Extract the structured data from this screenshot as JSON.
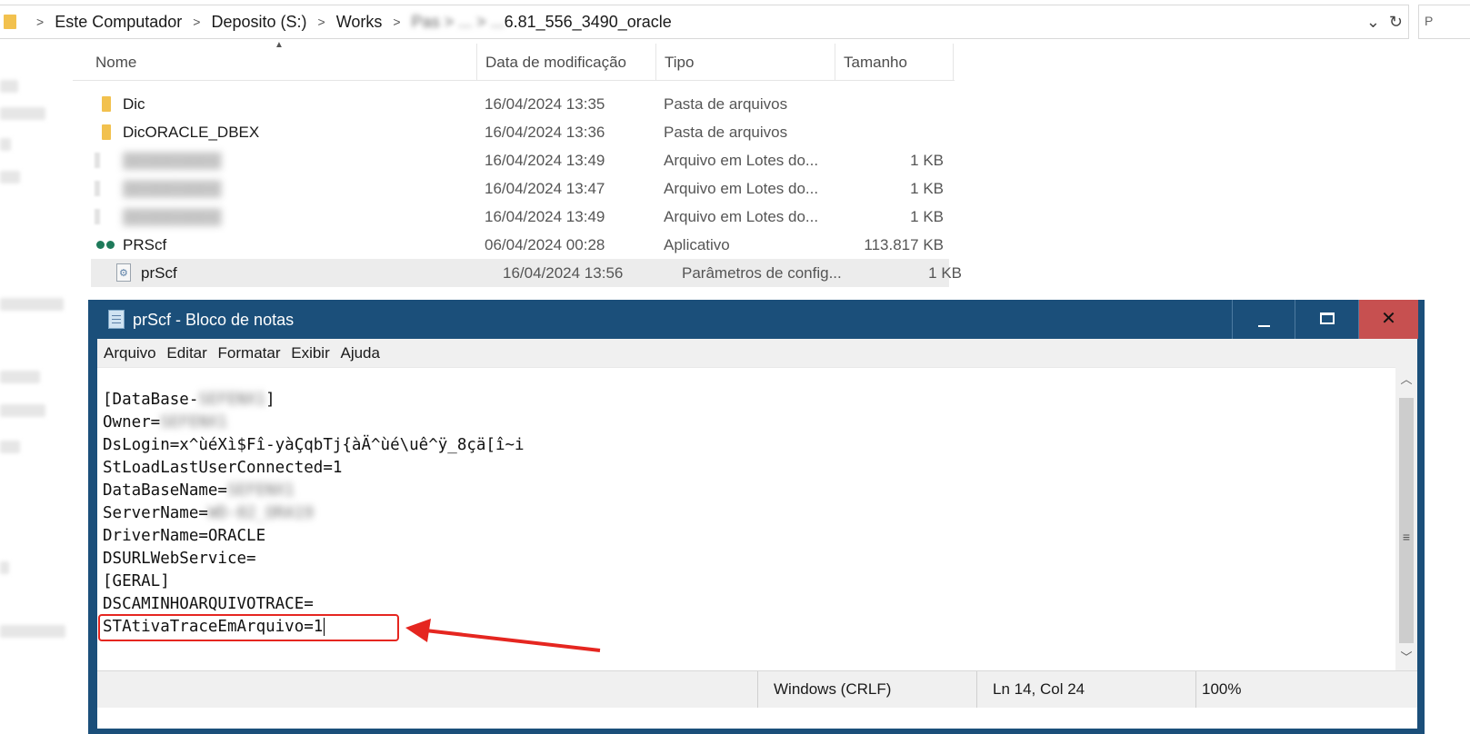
{
  "address_bar": {
    "crumbs": [
      "Este Computador",
      "Deposito (S:)",
      "Works",
      "6.81_556_3490_oracle"
    ],
    "blurred_crumb": "Pas > ... > ...",
    "refresh_icon": "refresh-icon",
    "dropdown_icon": "chevron-down-icon"
  },
  "file_list": {
    "columns": [
      "Nome",
      "Data de modificação",
      "Tipo",
      "Tamanho"
    ],
    "rows": [
      {
        "name": "Dic",
        "date": "16/04/2024 13:35",
        "type": "Pasta de arquivos",
        "size": "",
        "icon": "folder-icon"
      },
      {
        "name": "DicORACLE_DBEX",
        "date": "16/04/2024 13:36",
        "type": "Pasta de arquivos",
        "size": "",
        "icon": "folder-icon"
      },
      {
        "name": "",
        "date": "16/04/2024 13:49",
        "type": "Arquivo em Lotes do...",
        "size": "1 KB",
        "icon": "batch-file-icon"
      },
      {
        "name": "",
        "date": "16/04/2024 13:47",
        "type": "Arquivo em Lotes do...",
        "size": "1 KB",
        "icon": "batch-file-icon"
      },
      {
        "name": "",
        "date": "16/04/2024 13:49",
        "type": "Arquivo em Lotes do...",
        "size": "1 KB",
        "icon": "batch-file-icon"
      },
      {
        "name": "PRScf",
        "date": "06/04/2024 00:28",
        "type": "Aplicativo",
        "size": "113.817 KB",
        "icon": "application-icon"
      },
      {
        "name": "prScf",
        "date": "16/04/2024 13:56",
        "type": "Parâmetros de config...",
        "size": "1 KB",
        "icon": "config-file-icon",
        "selected": true
      }
    ]
  },
  "notepad": {
    "title": "prScf - Bloco de notas",
    "menu": [
      "Arquivo",
      "Editar",
      "Formatar",
      "Exibir",
      "Ajuda"
    ],
    "lines": [
      {
        "key": "[DataBase-",
        "redacted": "SEFENX1",
        "suffix": "]"
      },
      {
        "key": "Owner=",
        "redacted": "SEFENX1",
        "suffix": ""
      },
      {
        "key": "DsLogin=x^ùéXì$Fî-yàÇqbTj{àÄ^ùé\\uê^ÿ_8çä[î~i",
        "redacted": "",
        "suffix": ""
      },
      {
        "key": "StLoadLastUserConnected=1",
        "redacted": "",
        "suffix": ""
      },
      {
        "key": "DataBaseName=",
        "redacted": "SEFENX1",
        "suffix": ""
      },
      {
        "key": "ServerName=",
        "redacted": "WD-02_ORA19",
        "suffix": ""
      },
      {
        "key": "DriverName=ORACLE",
        "redacted": "",
        "suffix": ""
      },
      {
        "key": "DSURLWebService=",
        "redacted": "",
        "suffix": ""
      },
      {
        "key": "[GERAL]",
        "redacted": "",
        "suffix": ""
      },
      {
        "key": "DSCAMINHOARQUIVOTRACE=",
        "redacted": "",
        "suffix": ""
      },
      {
        "key": "STAtivaTraceEmArquivo=1",
        "redacted": "",
        "suffix": ""
      }
    ],
    "status": {
      "encoding": "Windows (CRLF)",
      "position": "Ln 14, Col 24",
      "zoom": "100%"
    }
  },
  "annotation": {
    "color": "#e52620"
  }
}
